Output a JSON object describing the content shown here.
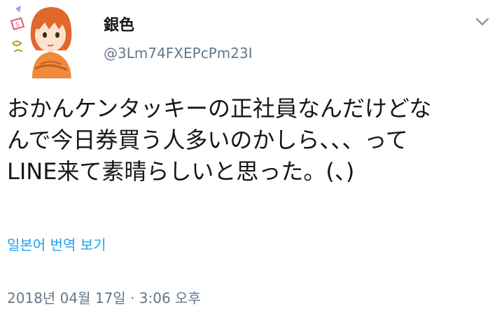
{
  "author": {
    "display_name": "銀色",
    "handle": "@3Lm74FXEPcPm23I"
  },
  "tweet": {
    "text": "おかんケンタッキーの正社員なんだけどな\nんで今日券買う人多いのかしら、、、って\nLINE来て素晴らしいと思った。(、)"
  },
  "actions": {
    "translate_label": "일본어 번역 보기"
  },
  "meta": {
    "timestamp": "2018년 04월 17일 · 3:06 오후"
  },
  "icons": {
    "menu": "chevron-down-icon",
    "avatar": "avatar-illustration"
  },
  "colors": {
    "link": "#1da1f2",
    "secondary_text": "#657786",
    "primary_text": "#14171a",
    "avatar_hair": "#e0682a",
    "avatar_shirt": "#f08a3c"
  }
}
